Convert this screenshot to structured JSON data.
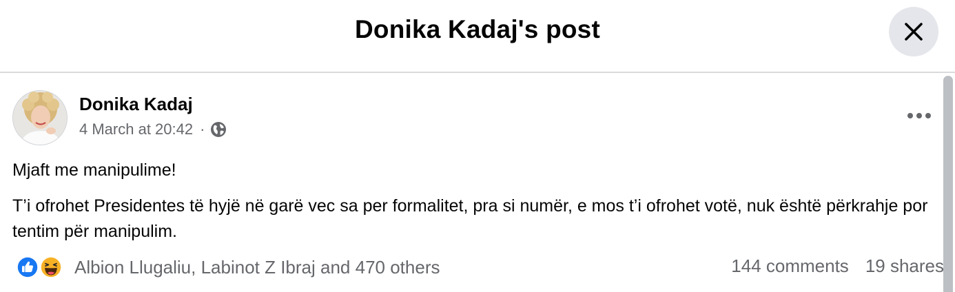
{
  "header": {
    "title": "Donika Kadaj's post"
  },
  "post": {
    "author": "Donika Kadaj",
    "timestamp": "4 March at 20:42",
    "separator": "·",
    "audience_icon": "globe-icon",
    "paragraphs": [
      "Mjaft me manipulime!",
      "T’i ofrohet Presidentes të hyjë në garë vec sa per formalitet, pra si numër, e mos t’i ofrohet votë, nuk është përkrahje por tentim për manipulim."
    ]
  },
  "footer": {
    "reaction_icons": [
      "like-reaction-icon",
      "haha-reaction-icon"
    ],
    "reactors": "Albion Llugaliu, Labinot Z Ibraj and 470 others",
    "comments": "144 comments",
    "shares": "19 shares"
  },
  "colors": {
    "like_blue": "#1877f2",
    "haha_yellow": "#f7b125",
    "secondary_text": "#65676b",
    "button_bg": "#e4e6eb"
  }
}
